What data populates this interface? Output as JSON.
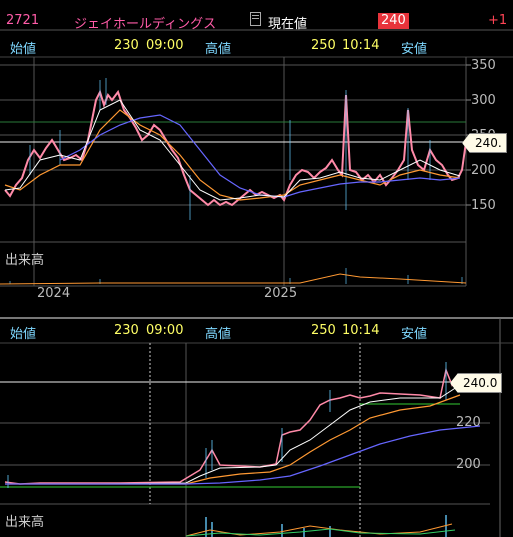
{
  "header": {
    "code": "2721",
    "name": "ジェイホールディングス",
    "doc_icon": "document-icon",
    "current_label": "現在値",
    "current_value": "240",
    "change": "+1"
  },
  "ohlc": {
    "open_label": "始値",
    "open_value": "230",
    "open_time": "09:00",
    "high_label": "高値",
    "high_value": "250",
    "high_time": "10:14",
    "low_label": "安値"
  },
  "top_chart": {
    "y_ticks": [
      "350",
      "300",
      "250",
      "200",
      "150"
    ],
    "price_tag": "240.",
    "volume_label": "出来高",
    "x_ticks": [
      "2024",
      "2025"
    ]
  },
  "bottom_chart": {
    "y_ticks": [
      "220",
      "200"
    ],
    "price_tag": "240.0",
    "volume_label": "出来高"
  },
  "colors": {
    "accent": "#ff5ca8",
    "label": "#7fd8ff",
    "value": "#ffff66",
    "badge": "#e8333b"
  },
  "chart_data": [
    {
      "type": "line",
      "title": "",
      "xlabel": "",
      "ylabel": "",
      "x": [
        "2023-10",
        "2023-12",
        "2024-01",
        "2024-02",
        "2024-03",
        "2024-04",
        "2024-05",
        "2024-06",
        "2024-07",
        "2024-08",
        "2024-09",
        "2024-10",
        "2024-11",
        "2024-12",
        "2025-01",
        "2025-02",
        "2025-03",
        "2025-04",
        "2025-05",
        "2025-06",
        "2025-07",
        "2025-08",
        "2025-09"
      ],
      "series": [
        {
          "values": [
            170,
            175,
            200,
            210,
            195,
            230,
            300,
            280,
            260,
            250,
            200,
            175,
            155,
            150,
            160,
            170,
            200,
            210,
            190,
            180,
            210,
            200,
            240
          ]
        }
      ],
      "ylim": [
        120,
        360
      ]
    },
    {
      "type": "line",
      "title": "",
      "xlabel": "",
      "ylabel": "",
      "series": [
        {
          "values": [
            190,
            190,
            190,
            190,
            190,
            192,
            205,
            204,
            205,
            206,
            216,
            222,
            228,
            233,
            231,
            232,
            234,
            236,
            232,
            240
          ]
        }
      ],
      "ylim": [
        180,
        245
      ]
    }
  ]
}
